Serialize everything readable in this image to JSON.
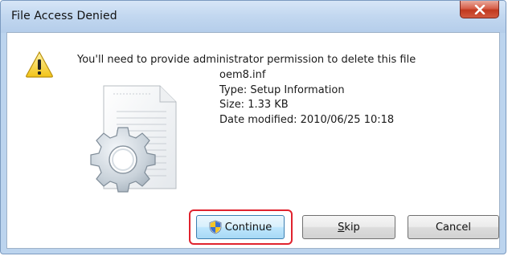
{
  "window": {
    "title": "File Access Denied"
  },
  "message": "You'll need to provide administrator permission to delete this file",
  "file": {
    "name": "oem8.inf",
    "type": "Type: Setup Information",
    "size": "Size: 1.33 KB",
    "date_modified": "Date modified: 2010/06/25 10:18"
  },
  "buttons": {
    "continue": "Continue",
    "skip_mnemonic": "S",
    "skip_rest": "kip",
    "cancel": "Cancel"
  },
  "icons": {
    "close": "close-icon",
    "warning": "warning-icon",
    "file": "setup-file-icon",
    "shield": "uac-shield-icon"
  },
  "colors": {
    "titlebar": "#c3d8f0",
    "close_button": "#c0391f",
    "highlight": "#e0232e",
    "default_button_border": "#3c7fb1"
  }
}
